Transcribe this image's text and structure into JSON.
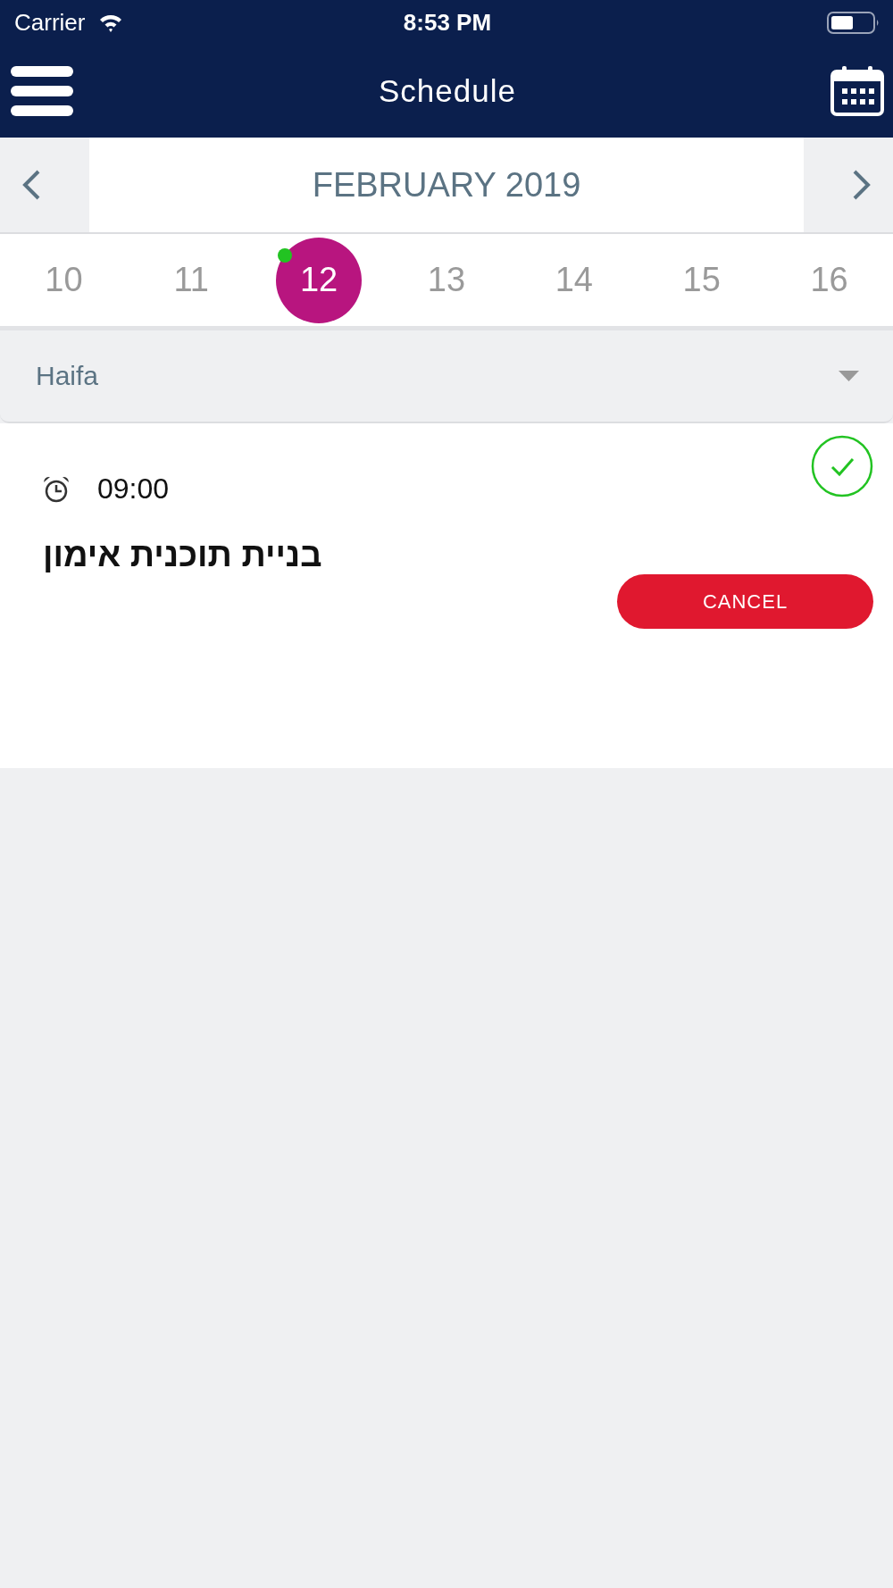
{
  "status_bar": {
    "carrier": "Carrier",
    "time": "8:53 PM"
  },
  "nav_bar": {
    "title": "Schedule"
  },
  "month_nav": {
    "title": "FEBRUARY 2019"
  },
  "days": [
    {
      "label": "10",
      "selected": false,
      "has_event": false
    },
    {
      "label": "11",
      "selected": false,
      "has_event": false
    },
    {
      "label": "12",
      "selected": true,
      "has_event": true
    },
    {
      "label": "13",
      "selected": false,
      "has_event": false
    },
    {
      "label": "14",
      "selected": false,
      "has_event": false
    },
    {
      "label": "15",
      "selected": false,
      "has_event": false
    },
    {
      "label": "16",
      "selected": false,
      "has_event": false
    }
  ],
  "location_select": {
    "value": "Haifa"
  },
  "events": [
    {
      "time": "09:00",
      "title": "בניית תוכנית אימון",
      "confirmed": true,
      "action": "CANCEL"
    }
  ]
}
